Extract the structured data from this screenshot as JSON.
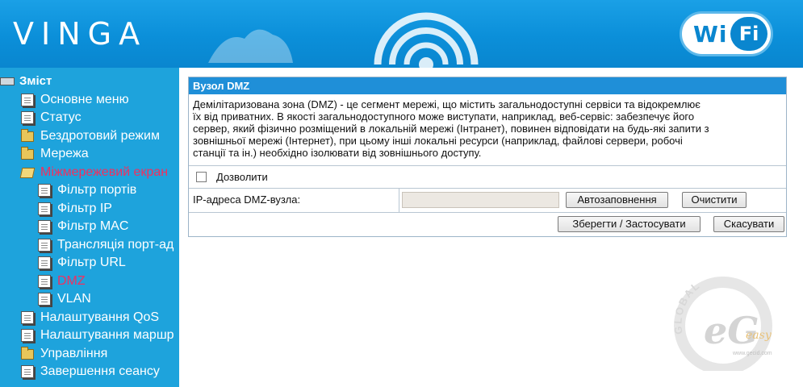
{
  "header": {
    "brand": "VINGA",
    "wifi_badge_left": "Wi",
    "wifi_badge_right": "Fi"
  },
  "sidebar": {
    "items": [
      {
        "label": "Зміст",
        "icon": "computer-icon"
      },
      {
        "label": "Основне меню",
        "icon": "document-icon"
      },
      {
        "label": "Статус",
        "icon": "document-icon"
      },
      {
        "label": "Бездротовий режим",
        "icon": "folder-icon"
      },
      {
        "label": "Мережа",
        "icon": "folder-icon"
      },
      {
        "label": "Міжмережевий екран",
        "icon": "open-folder-icon",
        "active": true
      },
      {
        "label": "Фільтр портів",
        "icon": "document-icon"
      },
      {
        "label": "Фільтр IP",
        "icon": "document-icon"
      },
      {
        "label": "Фільтр MAC",
        "icon": "document-icon"
      },
      {
        "label": "Трансляція порт-ад",
        "icon": "document-icon"
      },
      {
        "label": "Фільтр URL",
        "icon": "document-icon"
      },
      {
        "label": "DMZ",
        "icon": "document-icon",
        "active": true
      },
      {
        "label": "VLAN",
        "icon": "document-icon"
      },
      {
        "label": "Налаштування QoS",
        "icon": "document-icon"
      },
      {
        "label": "Налаштування маршр",
        "icon": "document-icon"
      },
      {
        "label": "Управління",
        "icon": "folder-icon"
      },
      {
        "label": "Завершення сеансу",
        "icon": "document-icon"
      }
    ],
    "active_color": "#f03060"
  },
  "dmz": {
    "title": "Вузол DMZ",
    "description_lines": [
      "Демілітаризована зона (DMZ) - це сегмент мережі, що містить загальнодоступні сервіси та відокремлює",
      "їх від приватних. В якості загальнодоступного може виступати, наприклад, веб-сервіс: забезпечує його",
      "сервер, який фізично розміщений в локальній мережі (Інтранет), повинен відповідати на будь-які запити з",
      "зовнішньої мережі (Інтернет), при цьому інші локальні ресурси (наприклад, файлові сервери, робочі",
      "станції та ін.) необхідно ізолювати від зовнішнього доступу."
    ],
    "enable_label": "Дозволити",
    "enable_checked": false,
    "ip_label": "IP-адреса DMZ-вузла:",
    "ip_value": "",
    "autofill_label": "Автозаповнення",
    "clear_label": "Очистити",
    "save_label": "Зберегти / Застосувати",
    "cancel_label": "Скасувати"
  },
  "watermark": {
    "ring_text": "GLOBAL",
    "letters": "eG",
    "word": "easy",
    "url": "www.gecid.com"
  },
  "colors": {
    "header_blue": "#0b8fd9",
    "sidebar_blue": "#1ea3dc",
    "panel_title_blue": "#1f8fd8"
  }
}
